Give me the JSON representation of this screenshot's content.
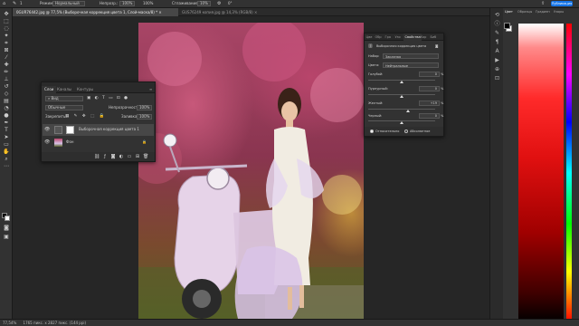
{
  "options": {
    "brush_size": "1",
    "mode_label": "Режим:",
    "mode_value": "Нормальный",
    "opacity_label": "Непрозр.:",
    "opacity_value": "100%",
    "flow_value": "100%",
    "smoothing_label": "Сглаживание:",
    "smoothing_value": "10%",
    "angle_value": "0°",
    "publish_label": "Публикация"
  },
  "tabs": [
    {
      "label": "0GUR76442.jpg @ 77,5% (Выборочная коррекция цвета 1, Слой-маска/8) *",
      "close": "×"
    },
    {
      "label": "GUS76249 копия.jpg @ 14,3% (RGB/8)",
      "close": "×"
    }
  ],
  "status": {
    "zoom": "77,54%",
    "doc_info": "1765 пикс. x 2827 пикс. (144 ppi)"
  },
  "color_panel": {
    "tabs": [
      "Цвет",
      "Образцы",
      "Градиен",
      "Узоры"
    ],
    "foreground": "#000000",
    "background": "#ffffff",
    "spectrum_color": "#ff2020"
  },
  "layers_panel": {
    "tabs": [
      "Слои",
      "Каналы",
      "Контуры"
    ],
    "search_label": "Вид",
    "blend_mode": "Обычные",
    "opacity_label": "Непрозрачность:",
    "opacity_value": "100%",
    "lock_label": "Закрепить:",
    "fill_label": "Заливка:",
    "fill_value": "100%",
    "layers": [
      {
        "name": "Выборочная коррекция цвета 1",
        "selected": true
      },
      {
        "name": "Фон",
        "selected": false
      }
    ],
    "footer_icons": [
      "link-icon",
      "fx-icon",
      "mask-icon",
      "adjustment-icon",
      "group-icon",
      "new-layer-icon",
      "trash-icon"
    ]
  },
  "properties_panel": {
    "tabs": [
      "Цве",
      "Обр",
      "Гра",
      "Узо",
      "Свойства",
      "Кор",
      "Биб"
    ],
    "title": "Выборочная коррекция цвета",
    "preset_label": "Набор:",
    "preset_value": "Заказная",
    "colors_label": "Цвета:",
    "colors_value": "Нейтральные",
    "sliders": [
      {
        "label": "Голубой:",
        "value": "0",
        "unit": "%",
        "level": 0
      },
      {
        "label": "Пурпурный:",
        "value": "0",
        "unit": "%",
        "level": 0
      },
      {
        "label": "Желтый:",
        "value": "+19",
        "unit": "%",
        "level": 19
      },
      {
        "label": "Черный:",
        "value": "0",
        "unit": "%",
        "level": 0
      }
    ],
    "method_relative": "Относительно",
    "method_absolute": "Абсолютное"
  }
}
